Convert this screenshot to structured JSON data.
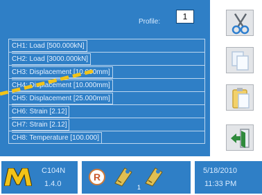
{
  "profile": {
    "label": "Profile:",
    "value": "1"
  },
  "channels": [
    {
      "label": "CH1: Load [500.000kN]"
    },
    {
      "label": "CH2: Load [3000.000kN]"
    },
    {
      "label": "CH3: Displacement [10.000mm]"
    },
    {
      "label": "CH4: Displacement [10.000mm]"
    },
    {
      "label": "CH5: Displacement [25.000mm]"
    },
    {
      "label": "CH6: Strain [2.12]"
    },
    {
      "label": "CH7: Strain [2.12]"
    },
    {
      "label": "CH8: Temperature [100.000]"
    }
  ],
  "toolbar": [
    {
      "name": "scissors-icon"
    },
    {
      "name": "copy-icon"
    },
    {
      "name": "paste-icon"
    },
    {
      "name": "exit-icon"
    }
  ],
  "status": {
    "model": "C104N",
    "version": "1.4.0",
    "interlock_letter": "R",
    "key_number": "1",
    "date": "5/18/2010",
    "time": "11:33 PM"
  },
  "colors": {
    "panel": "#2f7fc6",
    "laser": "#f2c318",
    "logo": "#f2c318"
  }
}
